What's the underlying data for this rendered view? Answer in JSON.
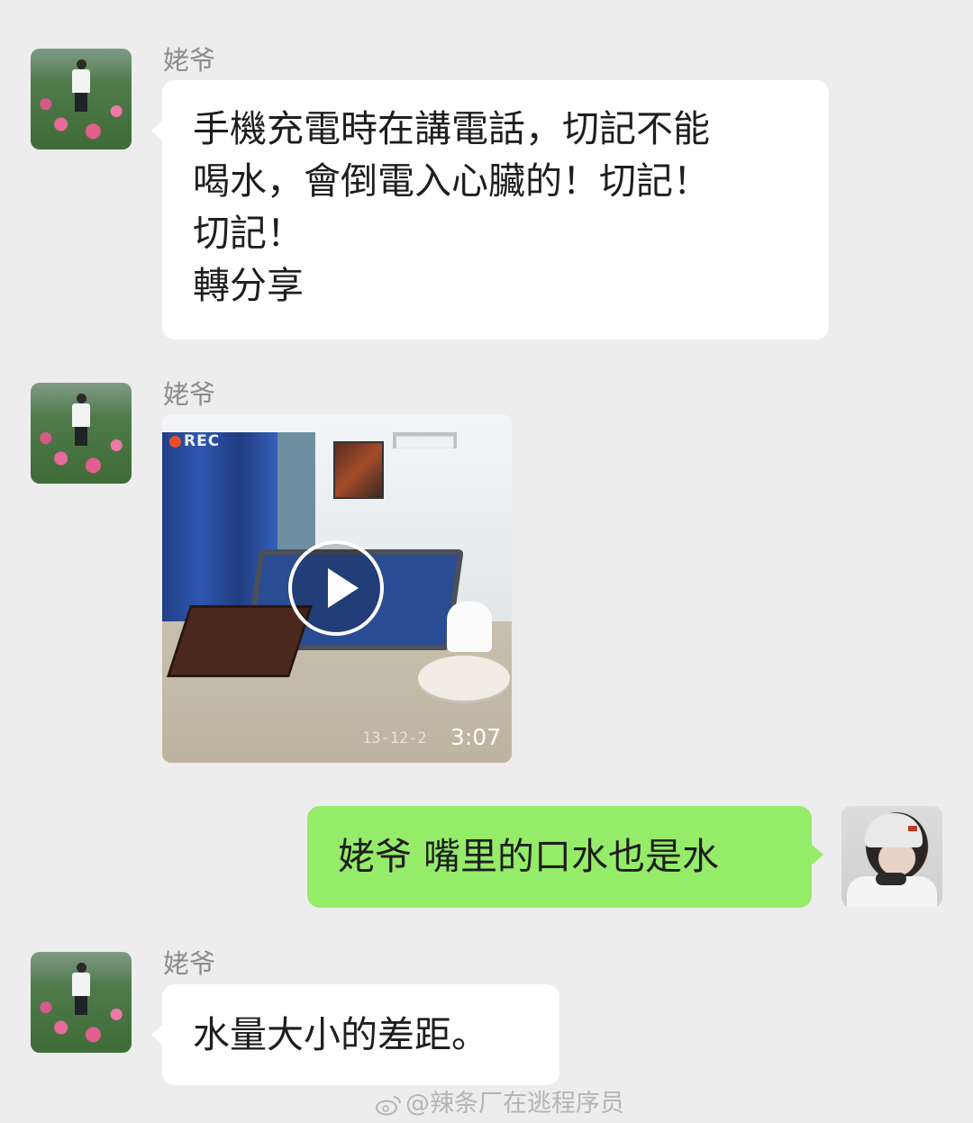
{
  "messages": [
    {
      "sender": "姥爷",
      "type": "text",
      "lines": [
        "手機充電時在講電話，切記不能",
        "喝水，會倒電入心臟的！切記！",
        "切記！",
        "轉分享"
      ]
    },
    {
      "sender": "姥爷",
      "type": "video",
      "overlay": {
        "rec": "REC",
        "timestamp_left": "13-12-2",
        "duration": "3:07"
      }
    },
    {
      "sender": "self",
      "type": "text",
      "text": "姥爷 嘴里的口水也是水"
    },
    {
      "sender": "姥爷",
      "type": "text",
      "text": "水量大小的差距。"
    }
  ],
  "colors": {
    "background": "#ededed",
    "incoming_bubble": "#ffffff",
    "outgoing_bubble": "#95ec69",
    "name": "#8c8c8c"
  },
  "watermark": {
    "icon": "weibo-icon",
    "text": "@辣条厂在逃程序员"
  }
}
